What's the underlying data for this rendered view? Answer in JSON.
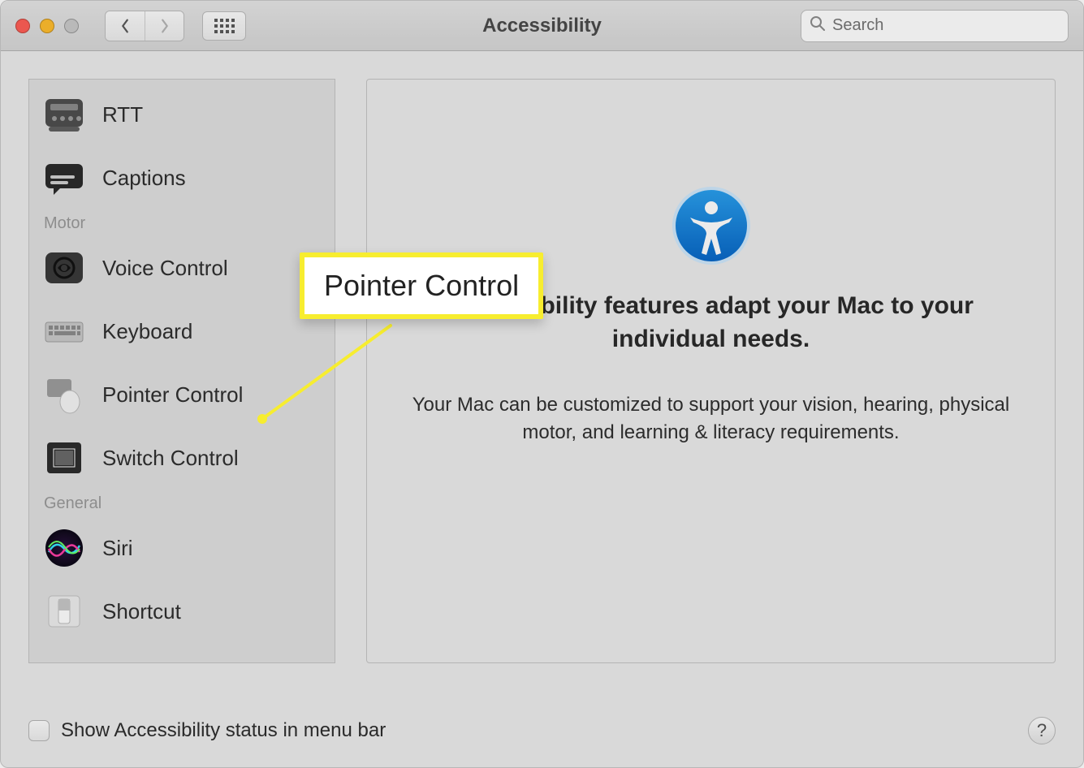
{
  "header": {
    "title": "Accessibility",
    "search_placeholder": "Search"
  },
  "sidebar": {
    "items": [
      {
        "label": "RTT"
      },
      {
        "label": "Captions"
      }
    ],
    "section_motor": "Motor",
    "motor_items": [
      {
        "label": "Voice Control"
      },
      {
        "label": "Keyboard"
      },
      {
        "label": "Pointer Control"
      },
      {
        "label": "Switch Control"
      }
    ],
    "section_general": "General",
    "general_items": [
      {
        "label": "Siri"
      },
      {
        "label": "Shortcut"
      }
    ]
  },
  "main": {
    "headline": "Accessibility features adapt your Mac to your individual needs.",
    "subline": "Your Mac can be customized to support your vision, hearing, physical motor, and learning & literacy requirements."
  },
  "bottom": {
    "checkbox_label": "Show Accessibility status in menu bar",
    "help": "?"
  },
  "callout": {
    "label": "Pointer Control"
  }
}
